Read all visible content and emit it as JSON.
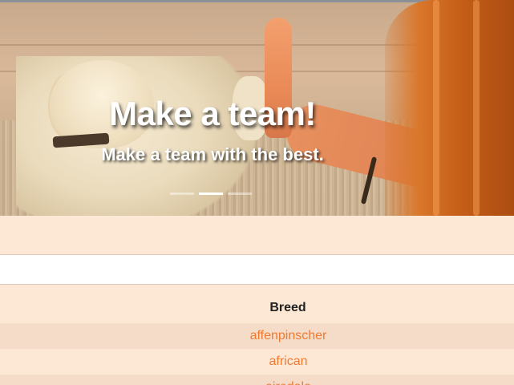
{
  "carousel": {
    "title": "Make a team!",
    "subtitle": "Make a team with the best.",
    "slide_count": 3,
    "active_slide": 2
  },
  "breeds_table": {
    "header": "Breed",
    "rows": [
      "affenpinscher",
      "african",
      "airedale"
    ]
  },
  "colors": {
    "page_background": "#fde8d6",
    "row_stripe": "#f4dcc9",
    "link": "#f07a30",
    "header_text": "#222222"
  }
}
